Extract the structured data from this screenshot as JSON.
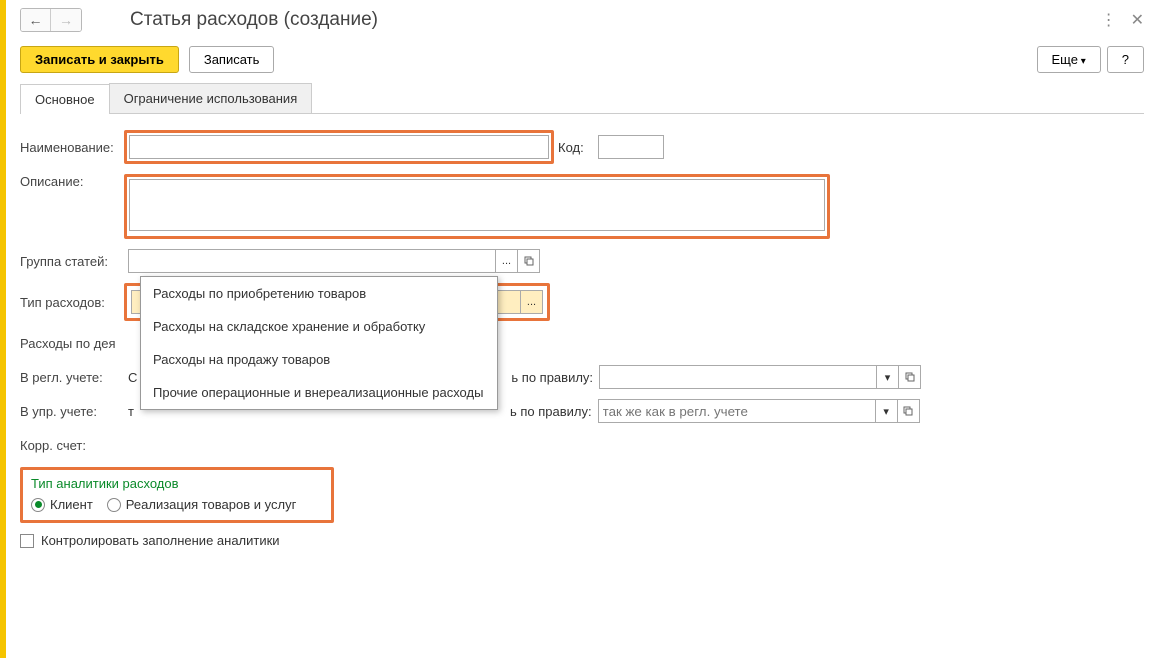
{
  "title": "Статья расходов (создание)",
  "toolbar": {
    "save_close": "Записать и закрыть",
    "save": "Записать",
    "more": "Еще",
    "help": "?"
  },
  "tabs": {
    "main": "Основное",
    "restrict": "Ограничение использования"
  },
  "form": {
    "name_label": "Наименование:",
    "name_value": "",
    "code_label": "Код:",
    "code_value": "",
    "desc_label": "Описание:",
    "desc_value": "",
    "group_label": "Группа статей:",
    "group_value": "",
    "type_label": "Тип расходов:",
    "type_value": "",
    "activity_label": "Расходы по дея",
    "regl_label": "В регл. учете:",
    "regl_value": "С",
    "upr_label": "В упр. учете:",
    "upr_value": "т",
    "rule_label": "ь по правилу:",
    "rule1_value": "",
    "rule2_placeholder": "так же как в регл. учете",
    "korr_label": "Корр. счет:"
  },
  "dropdown": {
    "item1": "Расходы по приобретению товаров",
    "item2": "Расходы на складское хранение и обработку",
    "item3": "Расходы на продажу товаров",
    "item4": "Прочие операционные и внереализационные расходы"
  },
  "analytics": {
    "title": "Тип аналитики расходов",
    "opt1": "Клиент",
    "opt2": "Реализация товаров и услуг",
    "control": "Контролировать заполнение аналитики"
  }
}
